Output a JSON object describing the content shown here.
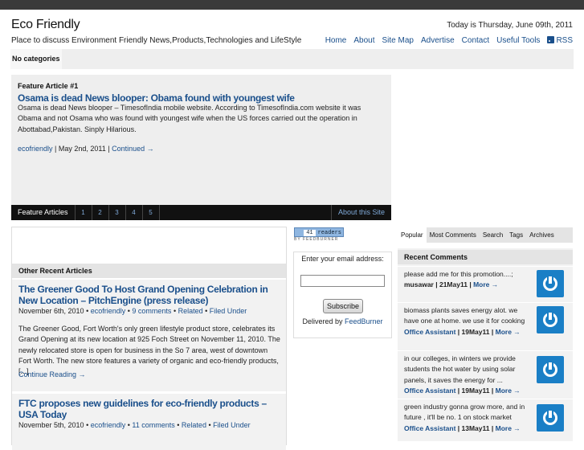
{
  "site": {
    "title": "Eco Friendly",
    "tagline": "Place to discuss Environment Friendly News,Products,Technologies and LifeStyle",
    "date": "Today is Thursday, June 09th, 2011"
  },
  "nav": [
    "Home",
    "About",
    "Site Map",
    "Advertise",
    "Contact",
    "Useful Tools",
    "RSS"
  ],
  "categories": {
    "label": "No categories"
  },
  "feature": {
    "label": "Feature Article #1",
    "title": "Osama is dead News blooper: Obama found with youngest wife",
    "text": "Osama is dead News blooper – TimesofIndia mobile website. According to TimesofIndia.com website it was Obama and not Osama who was found with youngest wife when the US forces carried out the operation in Abottabad,Pakistan. Sinply Hilarious.",
    "author": "ecofriendly",
    "date": "May 2nd, 2011",
    "continued": "Continued →",
    "tabs_label": "Feature Articles",
    "pages": [
      "1",
      "2",
      "3",
      "4",
      "5"
    ],
    "about": "About this Site"
  },
  "recent": {
    "heading": "Other Recent Articles",
    "posts": [
      {
        "title": "The Greener Good To Host Grand Opening Celebration in New Location – PitchEngine (press release)",
        "date": "November 6th, 2010",
        "author": "ecofriendly",
        "comments": "9 comments",
        "related": "Related",
        "filed": "Filed Under",
        "excerpt": "The Greener Good, Fort Worth's only green lifestyle product store, celebrates its Grand Opening at its new location at 925 Foch Street on November 11, 2010. The newly relocated store is open for business in the So 7 area, west of downtown Fort Worth. The new store features a variety of organic and eco-friendly products, [...]",
        "more": "Continue Reading →"
      },
      {
        "title": "FTC proposes new guidelines for eco-friendly products – USA Today",
        "date": "November 5th, 2010",
        "author": "ecofriendly",
        "comments": "11 comments",
        "related": "Related",
        "filed": "Filed Under"
      }
    ]
  },
  "feedburner": {
    "readers_count": "41",
    "readers_label": "readers",
    "by": "BY FEEDBURNER"
  },
  "subscribe": {
    "label": "Enter your email address:",
    "button": "Subscribe",
    "delivered": "Delivered by",
    "provider": "FeedBurner"
  },
  "sidebar_tabs": [
    "Popular",
    "Most Comments",
    "Search",
    "Tags",
    "Archives"
  ],
  "comments": {
    "heading": "Recent Comments",
    "items": [
      {
        "text": "please add me for this promotion....;",
        "user": "musawar",
        "date": "21May11",
        "more": "More →"
      },
      {
        "text": "biomass plants saves energy alot. we have one at home. we use it for cooking",
        "user": "Office Assistant",
        "date": "19May11",
        "more": "More →"
      },
      {
        "text": "in our colleges, in winters we provide students the hot water by using solar panels, it saves the energy for ...",
        "user": "Office Assistant",
        "date": "19May11",
        "more": "More →"
      },
      {
        "text": "green industry gonna grow more, and in future , it'll be no. 1 on stock market",
        "user": "Office Assistant",
        "date": "13May11",
        "more": "More →"
      }
    ]
  },
  "colors": {
    "link": "#1a4f8b",
    "panel": "#eeeeee",
    "dark_bar": "#111111",
    "avatar": "#1a7fc6"
  }
}
